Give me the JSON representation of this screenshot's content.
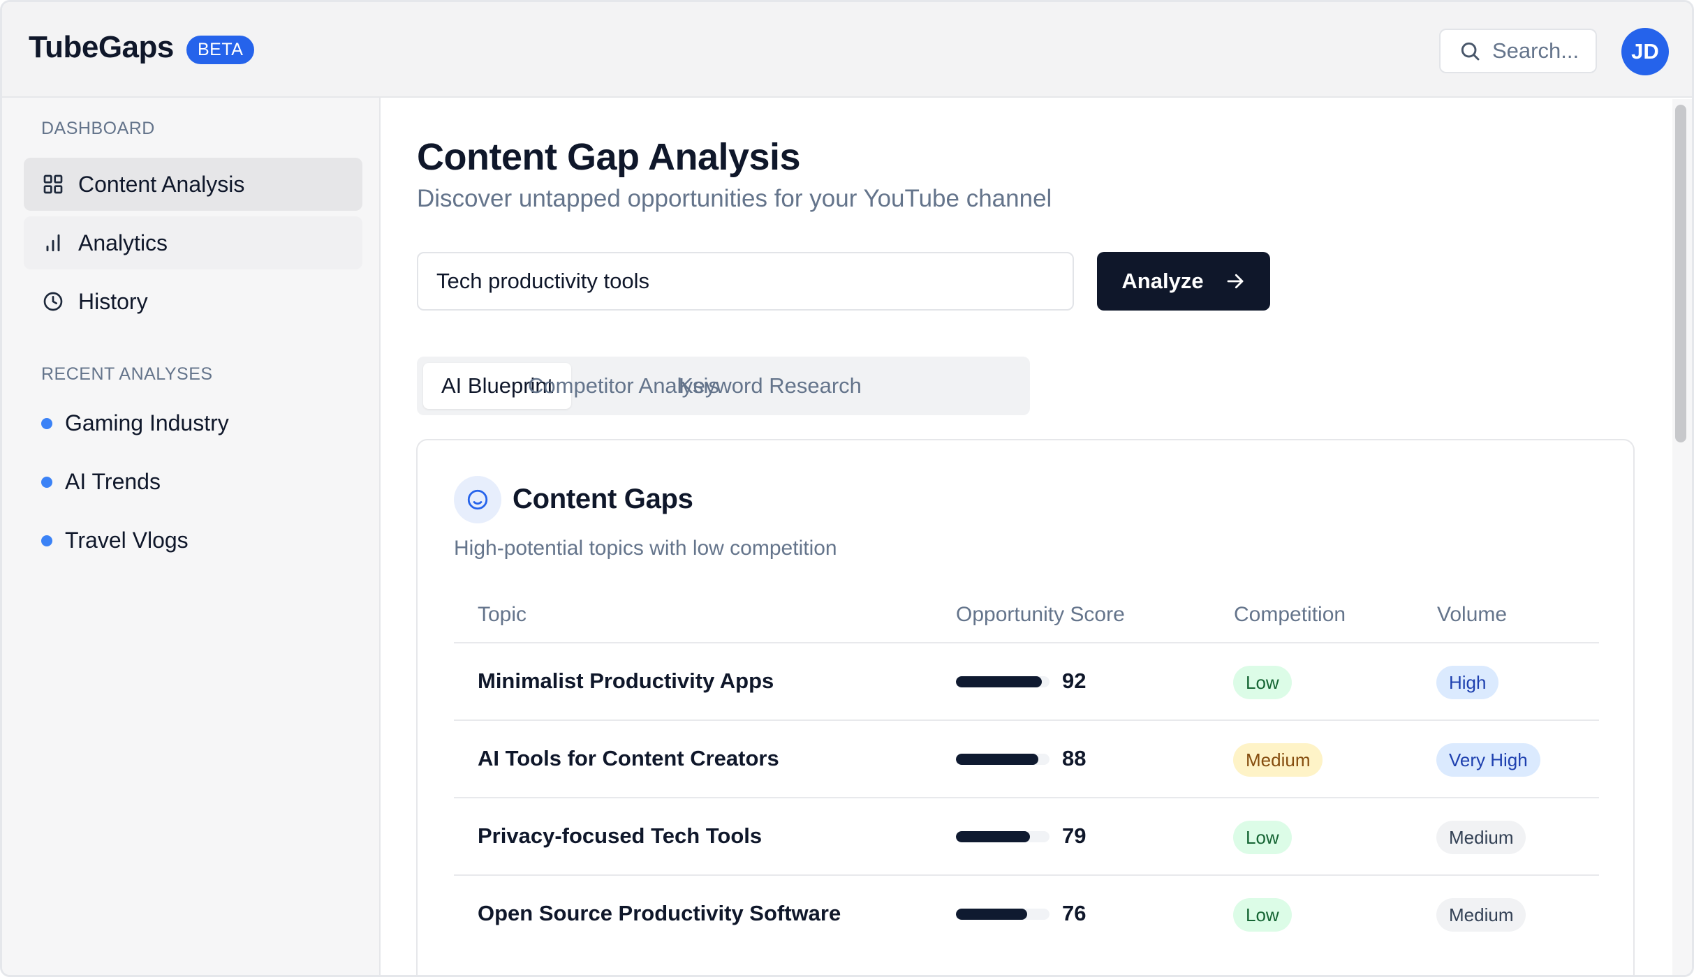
{
  "header": {
    "logo": "TubeGaps",
    "badge": "BETA",
    "search_placeholder": "Search...",
    "avatar_initials": "JD"
  },
  "sidebar": {
    "section_dashboard": "DASHBOARD",
    "nav": [
      {
        "label": "Content Analysis",
        "icon": "grid-icon",
        "active": true
      },
      {
        "label": "Analytics",
        "icon": "bar-chart-icon",
        "active": false
      },
      {
        "label": "History",
        "icon": "clock-icon",
        "active": false
      }
    ],
    "section_recent": "RECENT ANALYSES",
    "recent": [
      {
        "label": "Gaming Industry"
      },
      {
        "label": "AI Trends"
      },
      {
        "label": "Travel Vlogs"
      }
    ]
  },
  "main": {
    "title": "Content Gap Analysis",
    "subtitle": "Discover untapped opportunities for your YouTube channel",
    "input_value": "Tech productivity tools",
    "analyze_label": "Analyze",
    "tabs": [
      {
        "label": "AI Blueprint",
        "active": true
      },
      {
        "label": "Competitor Analysis",
        "active": false
      },
      {
        "label": "Keyword Research",
        "active": false
      }
    ],
    "card": {
      "title": "Content Gaps",
      "subtitle": "High-potential topics with low competition",
      "columns": [
        "Topic",
        "Opportunity Score",
        "Competition",
        "Volume"
      ],
      "rows": [
        {
          "topic": "Minimalist Productivity Apps",
          "score": "92",
          "score_fraction": 0.92,
          "competition": "Low",
          "volume": "High"
        },
        {
          "topic": "AI Tools for Content Creators",
          "score": "88",
          "score_fraction": 0.88,
          "competition": "Medium",
          "volume": "Very High"
        },
        {
          "topic": "Privacy-focused Tech Tools",
          "score": "79",
          "score_fraction": 0.79,
          "competition": "Low",
          "volume": "Medium"
        },
        {
          "topic": "Open Source Productivity Software",
          "score": "76",
          "score_fraction": 0.76,
          "competition": "Low",
          "volume": "Medium"
        }
      ]
    }
  },
  "colors": {
    "accent": "#2563eb",
    "primary_button": "#0f172a",
    "dot": "#3b82f6"
  }
}
